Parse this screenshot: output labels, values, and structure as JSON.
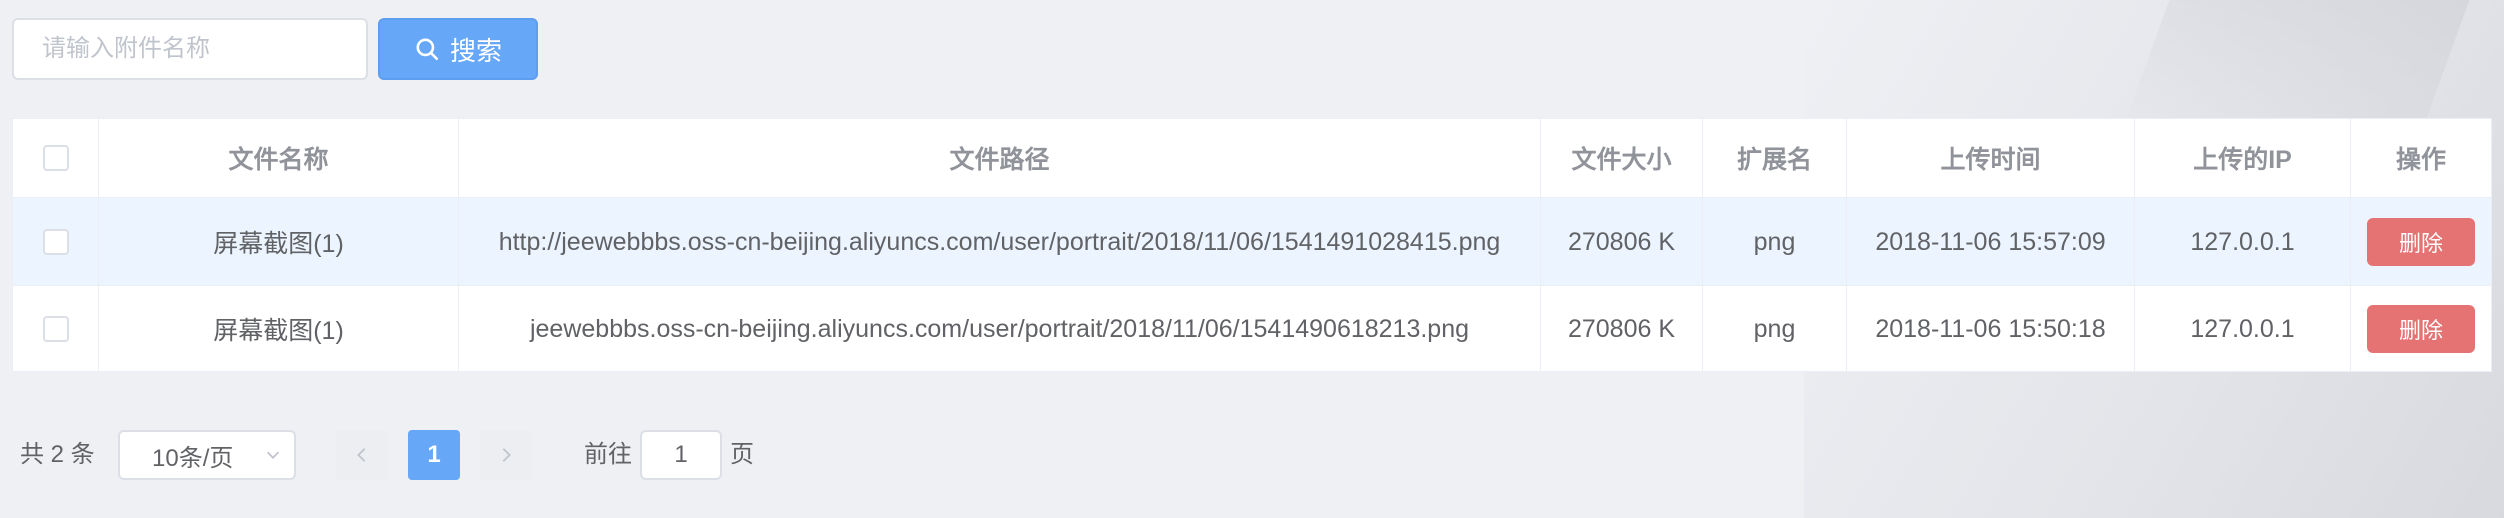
{
  "search": {
    "placeholder": "请输入附件名称",
    "value": "",
    "button_label": "搜索",
    "button_icon": "search-icon"
  },
  "table": {
    "columns": [
      "",
      "文件名称",
      "文件路径",
      "文件大小",
      "扩展名",
      "上传时间",
      "上传的IP",
      "操作"
    ],
    "rows": [
      {
        "name": "屏幕截图(1)",
        "path": "http://jeewebbbs.oss-cn-beijing.aliyuncs.com/user/portrait/2018/11/06/1541491028415.png",
        "size": "270806 K",
        "ext": "png",
        "time": "2018-11-06 15:57:09",
        "ip": "127.0.0.1",
        "action": "删除",
        "highlighted": true
      },
      {
        "name": "屏幕截图(1)",
        "path": "jeewebbbs.oss-cn-beijing.aliyuncs.com/user/portrait/2018/11/06/1541490618213.png",
        "size": "270806 K",
        "ext": "png",
        "time": "2018-11-06 15:50:18",
        "ip": "127.0.0.1",
        "action": "删除",
        "highlighted": false
      }
    ]
  },
  "pagination": {
    "total_text": "共 2 条",
    "page_size": "10条/页",
    "current_page": "1",
    "goto_label": "前往",
    "goto_value": "1",
    "goto_suffix": "页"
  },
  "colors": {
    "primary": "#66a7f7",
    "danger": "#e57373",
    "row_highlight": "#ecf5ff"
  }
}
